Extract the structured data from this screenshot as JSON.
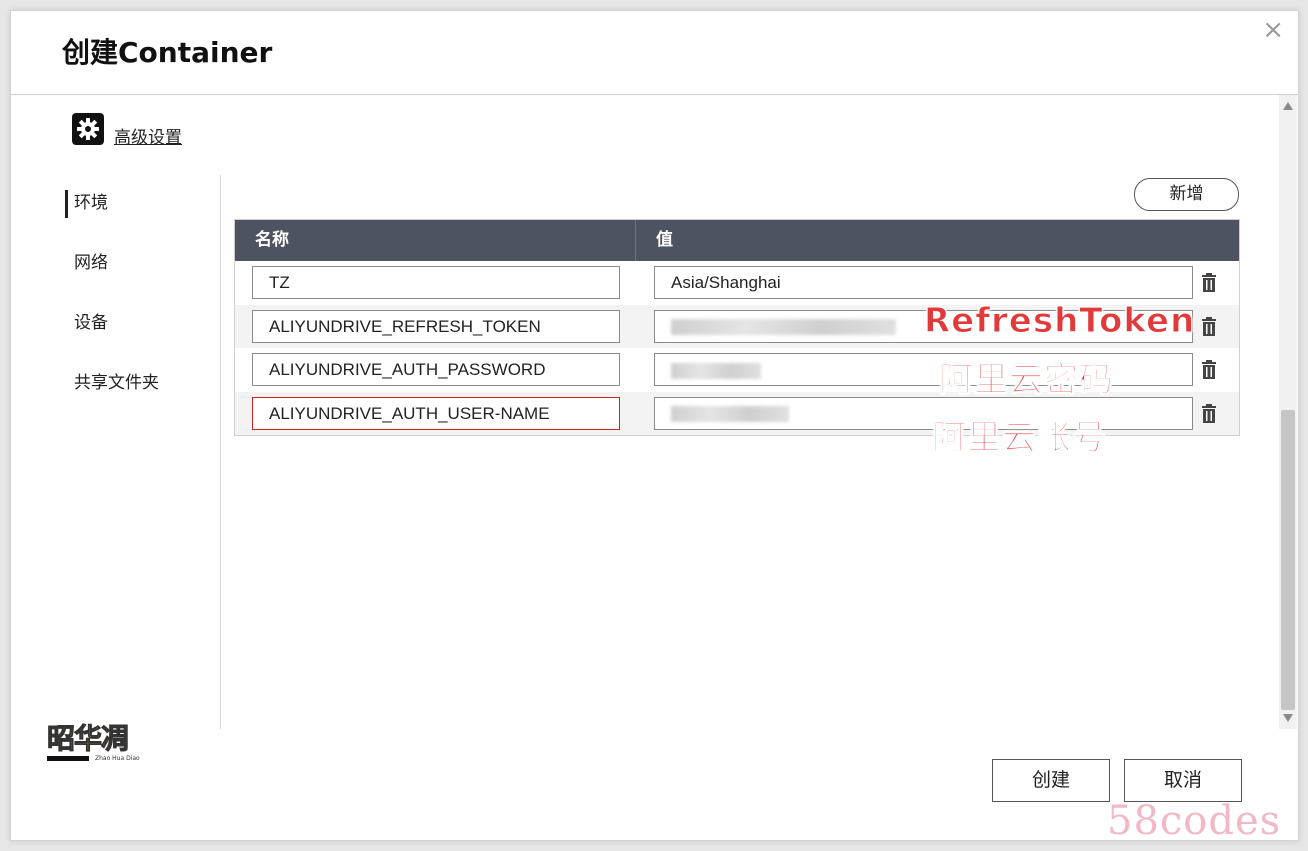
{
  "dialog": {
    "title": "创建Container",
    "close_icon": "×"
  },
  "advanced": {
    "label": "高级设置",
    "icon": "gear-icon"
  },
  "sidenav": {
    "items": [
      {
        "label": "环境",
        "active": true
      },
      {
        "label": "网络",
        "active": false
      },
      {
        "label": "设备",
        "active": false
      },
      {
        "label": "共享文件夹",
        "active": false
      }
    ]
  },
  "env_table": {
    "add_label": "新增",
    "columns": {
      "name": "名称",
      "value": "值"
    },
    "rows": [
      {
        "name": "TZ",
        "value": "Asia/Shanghai"
      },
      {
        "name": "ALIYUNDRIVE_REFRESH_TOKEN",
        "value": ""
      },
      {
        "name": "ALIYUNDRIVE_AUTH_PASSWORD",
        "value": ""
      },
      {
        "name": "ALIYUNDRIVE_AUTH_USER-NAME",
        "value": ""
      }
    ]
  },
  "annotations": {
    "refresh_token": "RefreshToken",
    "password": "阿里云密码",
    "account": "阿里云账号"
  },
  "footer": {
    "create_label": "创建",
    "cancel_label": "取消"
  },
  "logo": {
    "text": "昭华凋",
    "subtext": "Zhao Hua Diao"
  },
  "watermark": "58codes",
  "colors": {
    "table_header": "#4d5361",
    "annotation": "#e23a3a",
    "error_border": "#cc2222",
    "watermark": "#f2b8c6"
  }
}
